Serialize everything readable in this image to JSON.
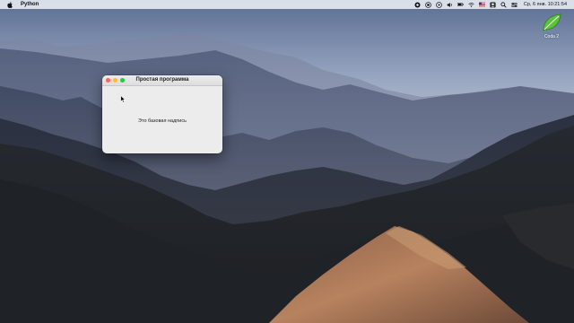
{
  "menubar": {
    "app_name": "Python",
    "datetime": "Ср, 6 янв.  10:21:54",
    "status_icons": [
      "record-icon",
      "stop-icon",
      "play-icon",
      "volume-icon",
      "battery-icon",
      "wifi-icon",
      "flag-icon",
      "user-icon",
      "search-icon",
      "control-center-icon"
    ]
  },
  "desktop": {
    "icon_label": "Coda 2"
  },
  "window": {
    "title": "Простая программа",
    "label": "Это базовая надпись"
  },
  "colors": {
    "close": "#ff5f57",
    "minimize": "#febc2e",
    "zoom": "#28c840"
  }
}
